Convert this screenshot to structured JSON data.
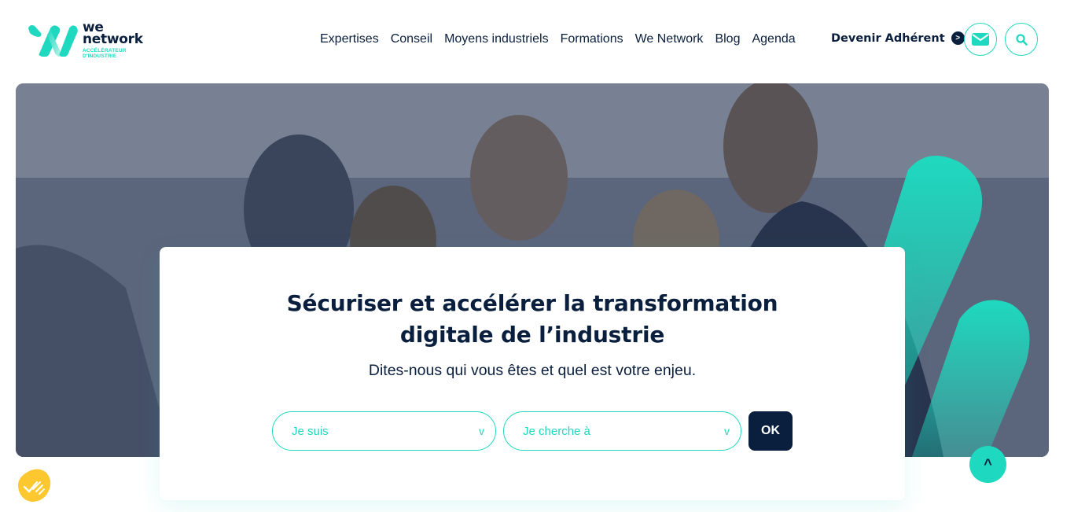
{
  "logo": {
    "line1": "we",
    "line2": "network",
    "tagline": "ACCÉLÉRATEUR D'INDUSTRIE"
  },
  "nav": {
    "items": [
      {
        "label": "Expertises"
      },
      {
        "label": "Conseil"
      },
      {
        "label": "Moyens industriels"
      },
      {
        "label": "Formations"
      },
      {
        "label": "We Network"
      },
      {
        "label": "Blog"
      },
      {
        "label": "Agenda"
      }
    ]
  },
  "cta": {
    "label": "Devenir Adhérent",
    "arrow": ">"
  },
  "icons": {
    "mail": "mail-icon",
    "search": "search-icon",
    "scroll_top": "^"
  },
  "hero": {
    "title_line1": "Sécuriser et accélérer la transformation",
    "title_line2": "digitale de l’industrie",
    "subtitle": "Dites-nous qui vous êtes et quel est votre enjeu.",
    "select1_label": "Je suis",
    "select2_label": "Je cherche à",
    "chevron": "v",
    "ok_label": "OK"
  },
  "colors": {
    "accent": "#1ed9bf",
    "navy": "#0a1f3d",
    "cookie": "#fdc82f"
  }
}
